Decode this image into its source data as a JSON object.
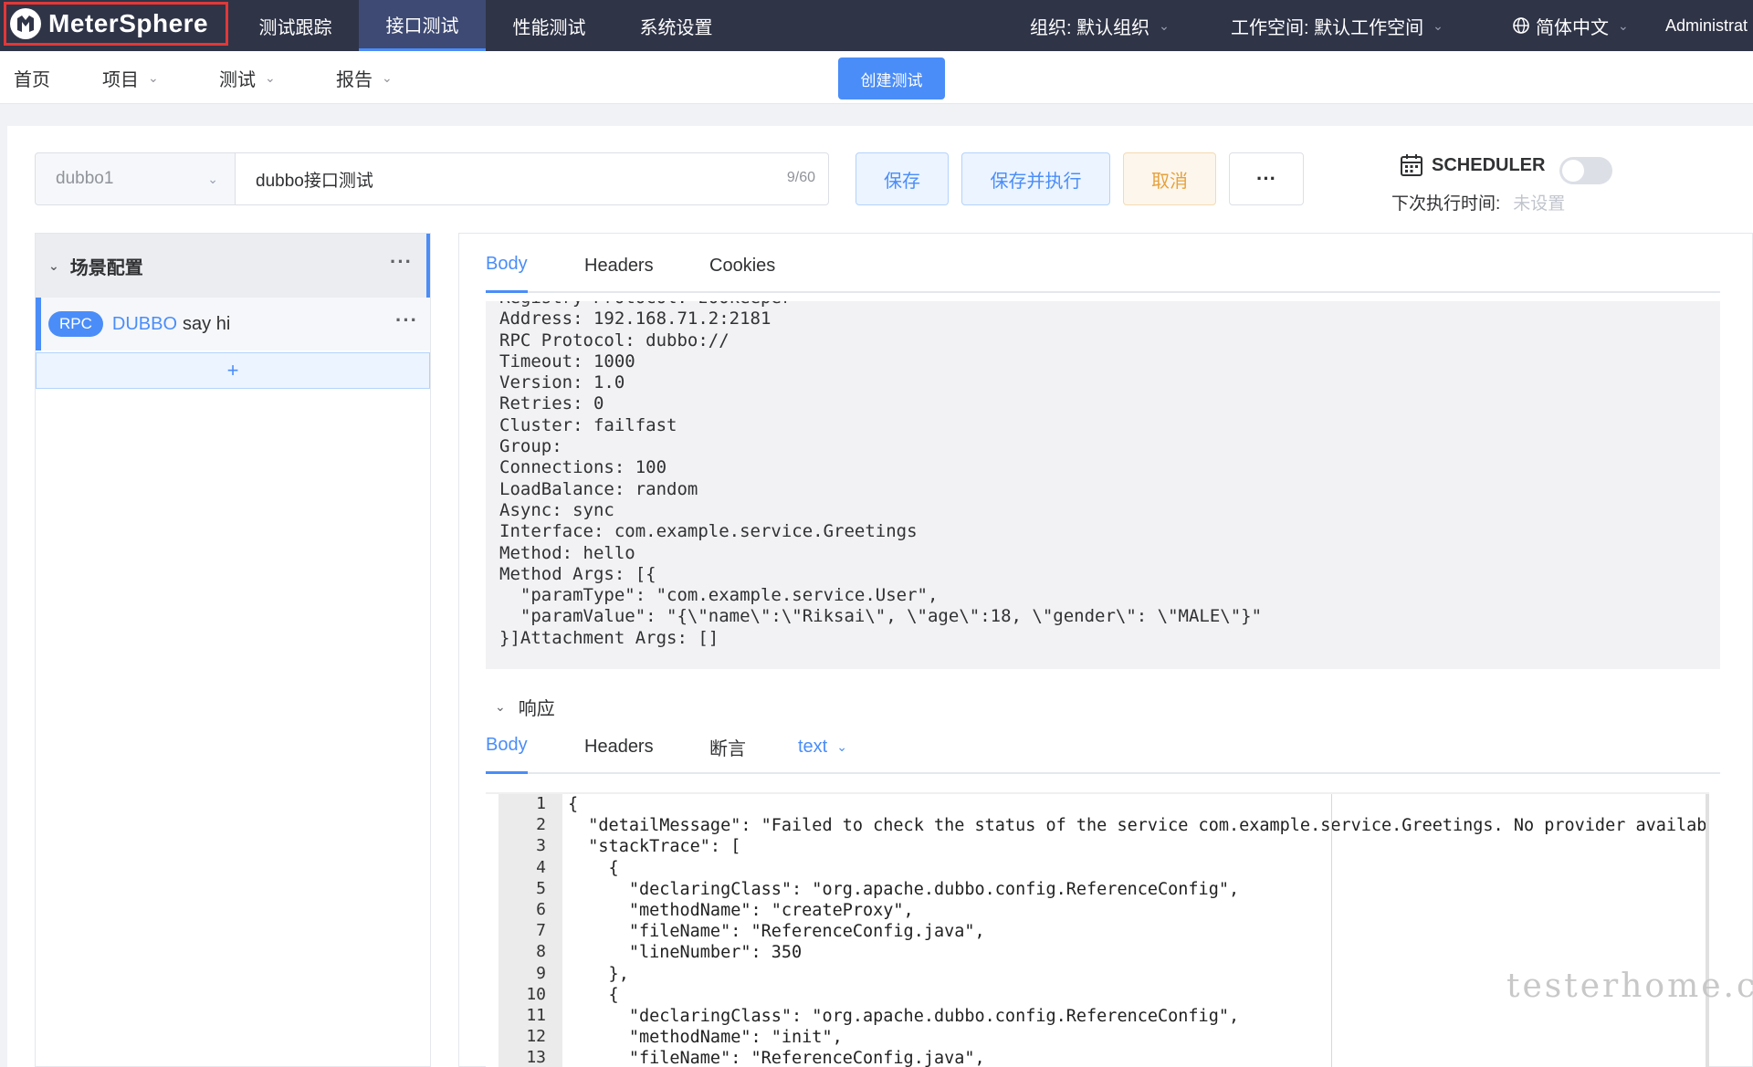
{
  "brand": {
    "name": "MeterSphere"
  },
  "topnav": [
    {
      "label": "测试跟踪"
    },
    {
      "label": "接口测试"
    },
    {
      "label": "性能测试"
    },
    {
      "label": "系统设置"
    }
  ],
  "top_right": {
    "org": "组织: 默认组织",
    "workspace": "工作空间: 默认工作空间",
    "language": "简体中文",
    "user": "Administrat"
  },
  "subnav": {
    "home": "首页",
    "project": "项目",
    "test": "测试",
    "report": "报告",
    "create": "创建测试"
  },
  "toolbar": {
    "project_select": "dubbo1",
    "test_name": "dubbo接口测试",
    "name_counter": "9/60",
    "save": "保存",
    "save_run": "保存并执行",
    "cancel": "取消",
    "more": "···"
  },
  "scheduler": {
    "label": "SCHEDULER",
    "enabled": false,
    "next_run_label": "下次执行时间:",
    "next_run_value": "未设置"
  },
  "scenario": {
    "title": "场景配置",
    "more": "···",
    "items": [
      {
        "tag": "RPC",
        "protocol": "DUBBO",
        "name": "say hi",
        "more": "···"
      }
    ],
    "add": "+"
  },
  "request": {
    "tabs": [
      "Body",
      "Headers",
      "Cookies"
    ],
    "active_tab": "Body",
    "body_lines": [
      "Registry Protocol: zookeeper",
      "Address: 192.168.71.2:2181",
      "RPC Protocol: dubbo://",
      "Timeout: 1000",
      "Version: 1.0",
      "Retries: 0",
      "Cluster: failfast",
      "Group:",
      "Connections: 100",
      "LoadBalance: random",
      "Async: sync",
      "Interface: com.example.service.Greetings",
      "Method: hello",
      "Method Args: [{",
      "  \"paramType\": \"com.example.service.User\",",
      "  \"paramValue\": \"{\\\"name\\\":\\\"Riksai\\\", \\\"age\\\":18, \\\"gender\\\": \\\"MALE\\\"}\"",
      "}]Attachment Args: []"
    ]
  },
  "response": {
    "title": "响应",
    "tabs": [
      "Body",
      "Headers",
      "断言"
    ],
    "active_tab": "Body",
    "format": "text",
    "lines": [
      {
        "n": "1",
        "text": "{"
      },
      {
        "n": "2",
        "text": "  \"detailMessage\": \"Failed to check the status of the service com.example.service.Greetings. No provider available for t"
      },
      {
        "n": "3",
        "text": "  \"stackTrace\": ["
      },
      {
        "n": "4",
        "text": "    {"
      },
      {
        "n": "5",
        "text": "      \"declaringClass\": \"org.apache.dubbo.config.ReferenceConfig\","
      },
      {
        "n": "6",
        "text": "      \"methodName\": \"createProxy\","
      },
      {
        "n": "7",
        "text": "      \"fileName\": \"ReferenceConfig.java\","
      },
      {
        "n": "8",
        "text": "      \"lineNumber\": 350"
      },
      {
        "n": "9",
        "text": "    },"
      },
      {
        "n": "10",
        "text": "    {"
      },
      {
        "n": "11",
        "text": "      \"declaringClass\": \"org.apache.dubbo.config.ReferenceConfig\","
      },
      {
        "n": "12",
        "text": "      \"methodName\": \"init\","
      },
      {
        "n": "13",
        "text": "      \"fileName\": \"ReferenceConfig.java\","
      }
    ]
  },
  "watermark": "testerhome.com",
  "colors": {
    "header_bg": "#2f3447",
    "accent": "#4a8df8",
    "cancel": "#e6a23c",
    "logo_border": "#e23838"
  }
}
